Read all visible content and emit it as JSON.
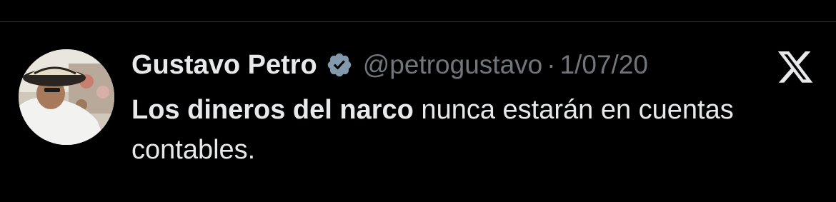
{
  "author": {
    "display_name": "Gustavo Petro",
    "handle": "@petrogustavo",
    "separator": "·",
    "date": "1/07/20",
    "verified": true,
    "verified_color": "#829aab"
  },
  "tweet": {
    "text_bold": "Los dineros del narco",
    "text_regular": " nunca estarán en cuentas contables."
  },
  "icons": {
    "platform_logo": "x-logo-icon",
    "verified_badge": "verified-badge-icon"
  },
  "colors": {
    "background": "#000000",
    "primary_text": "#e7e9ea",
    "secondary_text": "#71767b"
  }
}
